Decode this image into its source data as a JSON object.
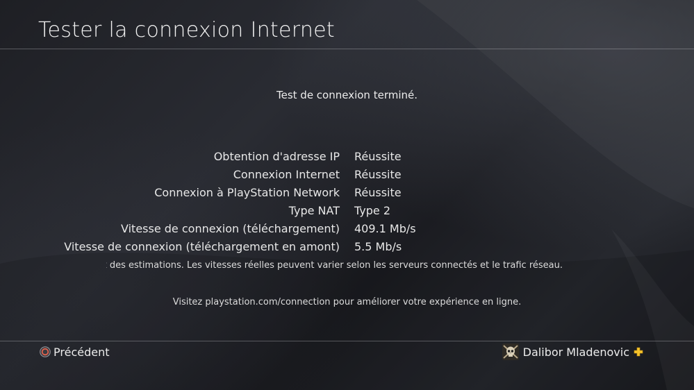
{
  "header": {
    "title": "Tester la connexion Internet"
  },
  "main": {
    "status": "Test de connexion terminé.",
    "results": [
      {
        "label": "Obtention d'adresse IP",
        "value": "Réussite"
      },
      {
        "label": "Connexion Internet",
        "value": "Réussite"
      },
      {
        "label": "Connexion à PlayStation Network",
        "value": "Réussite"
      },
      {
        "label": "Type NAT",
        "value": "Type 2"
      },
      {
        "label": "Vitesse de connexion (téléchargement)",
        "value": "409.1 Mb/s"
      },
      {
        "label": "Vitesse de connexion (téléchargement en amont)",
        "value": "5.5 Mb/s"
      }
    ],
    "note": "quement des estimations. Les vitesses réelles peuvent varier selon les serveurs connectés et le trafic réseau.",
    "visit": "Visitez playstation.com/connection pour améliorer votre expérience en ligne."
  },
  "footer": {
    "back_label": "Précédent",
    "back_icon": "circle-button-icon",
    "user_name": "Dalibor Mladenovic",
    "user_avatar": "skull-avatar",
    "plus_icon": "playstation-plus-icon"
  },
  "colors": {
    "background": "#222329",
    "text": "#ececec",
    "circle_button": "#e0634f",
    "plus": "#f4c22b"
  }
}
